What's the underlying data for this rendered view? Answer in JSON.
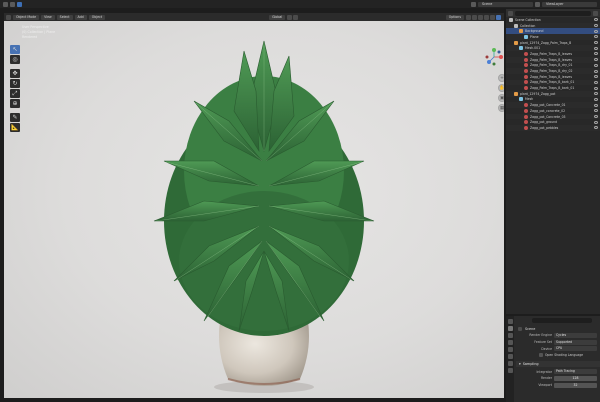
{
  "topbar": {
    "scene_label": "Scene",
    "view_layer_label": "ViewLayer"
  },
  "viewport_header": {
    "mode": "Object Mode",
    "menus": [
      "View",
      "Select",
      "Add",
      "Object"
    ],
    "transform_orientation": "Global",
    "pivot": "Options"
  },
  "viewport": {
    "info_lines": [
      "User Perspective",
      "(0) Collection | Plane",
      "Rendered"
    ]
  },
  "outliner": {
    "rows": [
      {
        "label": "Scene Collection",
        "icon": "collection-icon",
        "depth": 0,
        "selected": false
      },
      {
        "label": "Collection",
        "icon": "collection-icon",
        "depth": 1,
        "selected": false
      },
      {
        "label": "Background",
        "icon": "object-icon",
        "depth": 2,
        "selected": true
      },
      {
        "label": "Plane",
        "icon": "mesh-icon",
        "depth": 3,
        "selected": false
      },
      {
        "label": "plant_12974_Zagg_Palm_Traps_B",
        "icon": "object-icon",
        "depth": 1,
        "selected": false
      },
      {
        "label": "Mesh.001",
        "icon": "mesh-icon",
        "depth": 2,
        "selected": false
      },
      {
        "label": "Zagg_Palm_Traps_B_leaves",
        "icon": "material-icon",
        "depth": 3,
        "selected": false
      },
      {
        "label": "Zagg_Palm_Traps_B_leaves",
        "icon": "material-icon",
        "depth": 3,
        "selected": false
      },
      {
        "label": "Zagg_Palm_Traps_B_dry_01",
        "icon": "material-icon",
        "depth": 3,
        "selected": false
      },
      {
        "label": "Zagg_Palm_Traps_B_dry_02",
        "icon": "material-icon",
        "depth": 3,
        "selected": false
      },
      {
        "label": "Zagg_Palm_Traps_B_leaves",
        "icon": "material-icon",
        "depth": 3,
        "selected": false
      },
      {
        "label": "Zagg_Palm_Traps_B_bark_01",
        "icon": "material-icon",
        "depth": 3,
        "selected": false
      },
      {
        "label": "Zagg_Palm_Traps_B_bark_01",
        "icon": "material-icon",
        "depth": 3,
        "selected": false
      },
      {
        "label": "plant_12974_Zagg_pot",
        "icon": "object-icon",
        "depth": 1,
        "selected": false
      },
      {
        "label": "Mesh",
        "icon": "mesh-icon",
        "depth": 2,
        "selected": false
      },
      {
        "label": "Zagg_pot_Concrete_01",
        "icon": "material-icon",
        "depth": 3,
        "selected": false
      },
      {
        "label": "Zagg_pot_concrete_02",
        "icon": "material-icon",
        "depth": 3,
        "selected": false
      },
      {
        "label": "Zagg_pot_Concrete_03",
        "icon": "material-icon",
        "depth": 3,
        "selected": false
      },
      {
        "label": "Zagg_pot_ground",
        "icon": "material-icon",
        "depth": 3,
        "selected": false
      },
      {
        "label": "Zagg_pot_pebbles",
        "icon": "material-icon",
        "depth": 3,
        "selected": false
      }
    ]
  },
  "properties": {
    "panel_title": "Scene",
    "fields": [
      {
        "label": "Render Engine",
        "value": "Cycles"
      },
      {
        "label": "Feature Set",
        "value": "Supported"
      },
      {
        "label": "Device",
        "value": "CPU"
      }
    ],
    "checkbox_label": "Open Shading Language",
    "section_title": "Sampling",
    "sampling": [
      {
        "label": "Integrator",
        "value": "Path Tracing"
      },
      {
        "label": "Render",
        "value": "128"
      },
      {
        "label": "Viewport",
        "value": "32"
      }
    ]
  },
  "colors": {
    "accent": "#4772b3",
    "selection": "#334d80",
    "viewport_bg": "#dddcdb",
    "leaf": "#3f7d45"
  }
}
